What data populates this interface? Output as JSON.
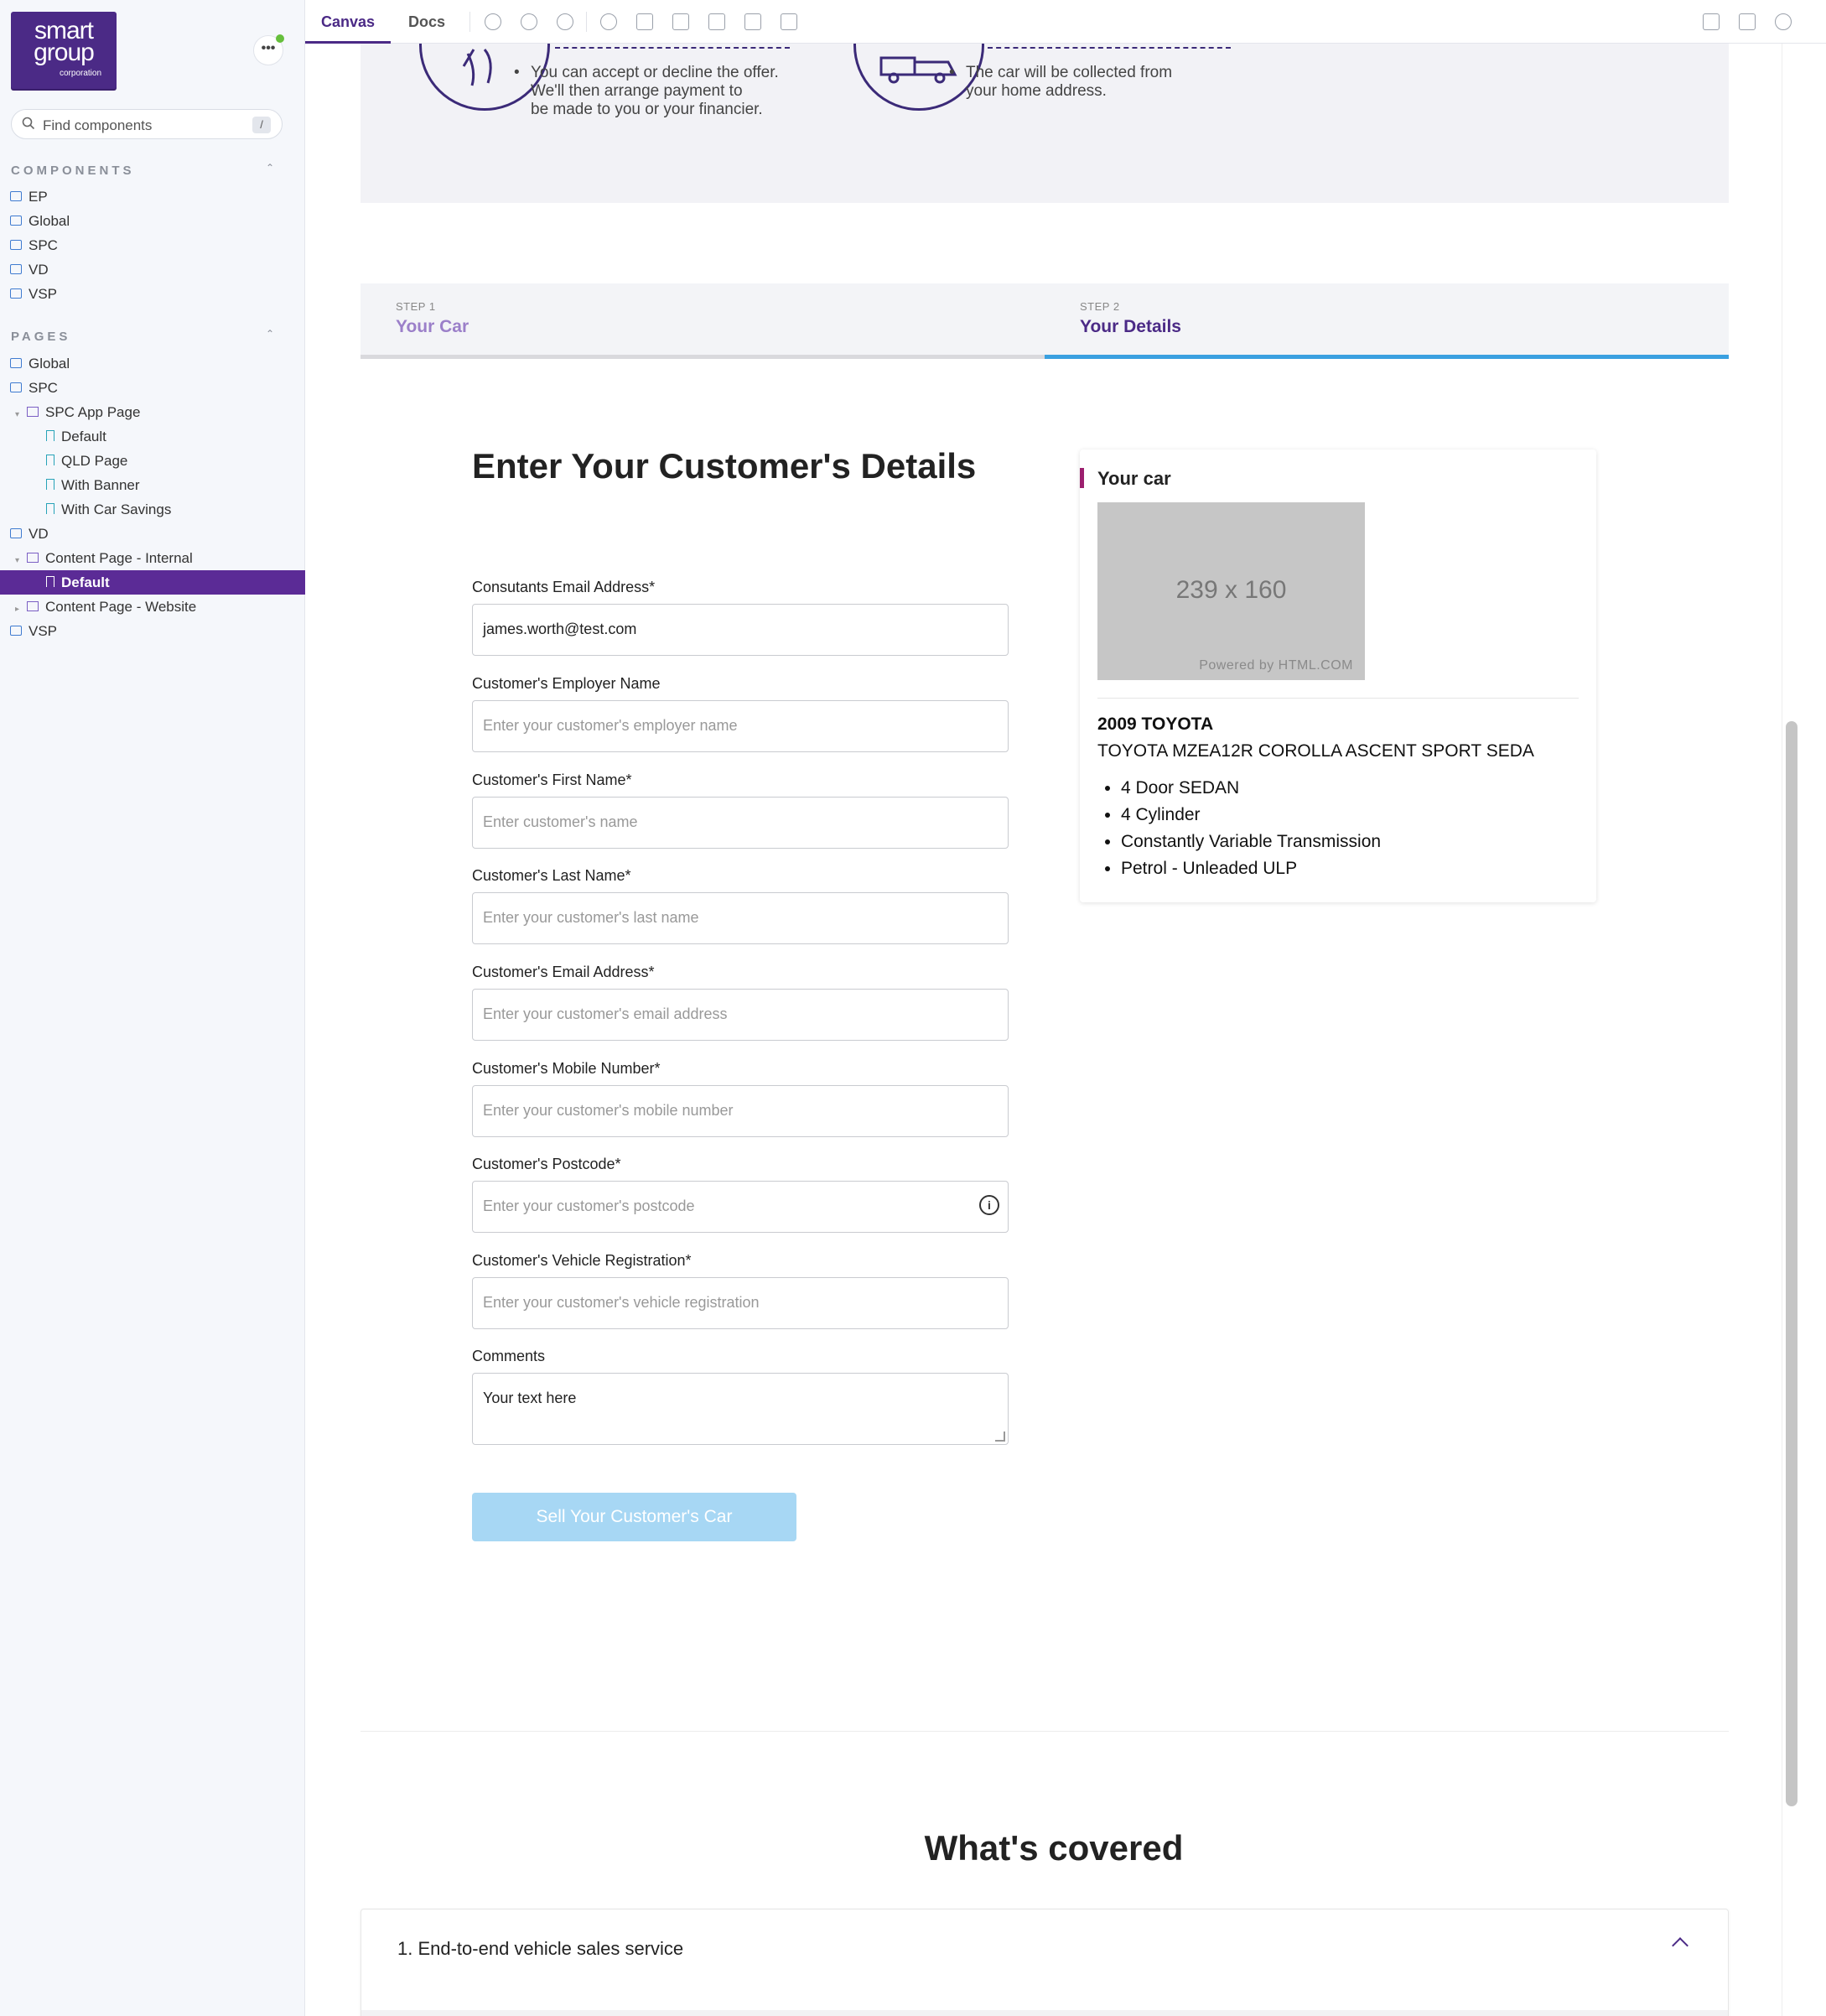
{
  "sidebar": {
    "logo": {
      "line1": "smart",
      "line2": "group",
      "line3": "corporation"
    },
    "search": {
      "placeholder": "Find components",
      "shortcut": "/"
    },
    "components_title": "COMPONENTS",
    "components": [
      "EP",
      "Global",
      "SPC",
      "VD",
      "VSP"
    ],
    "pages_title": "PAGES",
    "pages": [
      {
        "label": "Global",
        "type": "folder",
        "level": 0
      },
      {
        "label": "SPC",
        "type": "folder",
        "level": 0
      },
      {
        "label": "SPC App Page",
        "type": "component",
        "level": 1
      },
      {
        "label": "Default",
        "type": "story",
        "level": 2
      },
      {
        "label": "QLD Page",
        "type": "story",
        "level": 2
      },
      {
        "label": "With Banner",
        "type": "story",
        "level": 2
      },
      {
        "label": "With Car Savings",
        "type": "story",
        "level": 2
      },
      {
        "label": "VD",
        "type": "folder",
        "level": 0
      },
      {
        "label": "Content Page - Internal",
        "type": "component",
        "level": 1
      },
      {
        "label": "Default",
        "type": "story",
        "level": 2,
        "selected": true
      },
      {
        "label": "Content Page - Website",
        "type": "component",
        "level": 1
      },
      {
        "label": "VSP",
        "type": "folder",
        "level": 0
      }
    ]
  },
  "toolbar": {
    "tabs": [
      "Canvas",
      "Docs"
    ],
    "active_tab": "Canvas",
    "tools": [
      "zoom-in-icon",
      "zoom-out-icon",
      "zoom-reset-icon",
      "accessibility-icon",
      "image-icon",
      "grid-icon",
      "background-icon",
      "measure-icon",
      "outline-icon"
    ],
    "right_tools": [
      "fullscreen-icon",
      "open-new-tab-icon",
      "copy-link-icon"
    ]
  },
  "hero": {
    "bullet1": "You can accept or decline the offer.\nWe'll then arrange payment to\nbe made to you or your financier.",
    "bullet2": "The car will be collected from\nyour home address."
  },
  "steps": [
    {
      "num": "STEP 1",
      "label": "Your Car",
      "active": false
    },
    {
      "num": "STEP 2",
      "label": "Your Details",
      "active": true
    }
  ],
  "form": {
    "title": "Enter Your Customer's Details",
    "fields": [
      {
        "label": "Consutants Email Address*",
        "value": "james.worth@test.com",
        "placeholder": ""
      },
      {
        "label": "Customer's Employer Name",
        "value": "",
        "placeholder": "Enter your customer's employer name"
      },
      {
        "label": "Customer's First Name*",
        "value": "",
        "placeholder": "Enter customer's name"
      },
      {
        "label": "Customer's Last Name*",
        "value": "",
        "placeholder": "Enter your customer's last name"
      },
      {
        "label": "Customer's Email Address*",
        "value": "",
        "placeholder": "Enter your customer's email address"
      },
      {
        "label": "Customer's Mobile Number*",
        "value": "",
        "placeholder": "Enter your customer's mobile number"
      },
      {
        "label": "Customer's Postcode*",
        "value": "",
        "placeholder": "Enter your customer's postcode"
      },
      {
        "label": "Customer's Vehicle Registration*",
        "value": "",
        "placeholder": "Enter your customer's vehicle registration"
      }
    ],
    "comments_label": "Comments",
    "comments_value": "Your text here",
    "submit": "Sell Your Customer's Car"
  },
  "car": {
    "title": "Your car",
    "image_dims": "239 x 160",
    "image_credit": "Powered by HTML.COM",
    "year_make": "2009 TOYOTA",
    "model": "TOYOTA MZEA12R COROLLA ASCENT SPORT SEDA",
    "specs": [
      "4 Door SEDAN",
      "4 Cylinder",
      "Constantly Variable Transmission",
      "Petrol - Unleaded ULP"
    ]
  },
  "covered": {
    "title": "What's covered",
    "item1": "1. End-to-end vehicle sales service"
  },
  "colors": {
    "brand_purple": "#4b2a86",
    "step_active": "#3aa0e0",
    "button_disabled": "#a7d7f4",
    "accent_magenta": "#9c1f6e"
  }
}
